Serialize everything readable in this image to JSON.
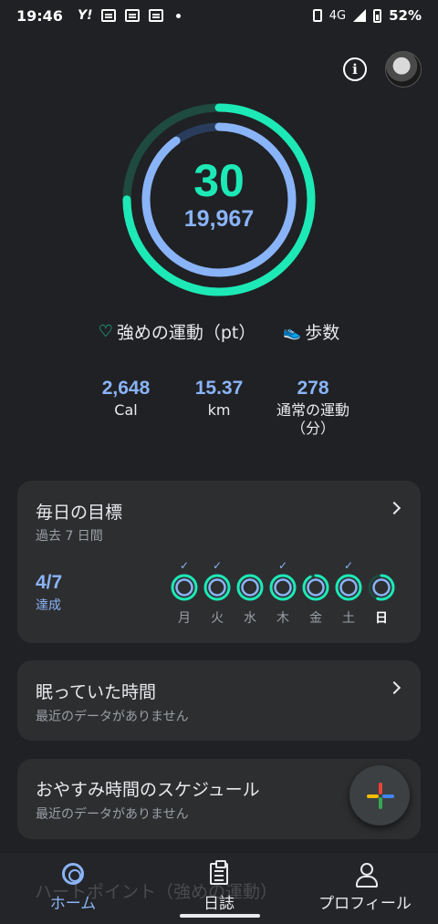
{
  "status_bar": {
    "time": "19:46",
    "yahoo_label": "Y!",
    "network": "4G",
    "battery_pct": "52%"
  },
  "summary": {
    "heart_points": "30",
    "steps": "19,967",
    "heart_points_progress": 0.75,
    "steps_progress": 0.9,
    "legend_heart_points": "強めの運動（pt）",
    "legend_steps": "歩数"
  },
  "stats": [
    {
      "value": "2,648",
      "label": "Cal"
    },
    {
      "value": "15.37",
      "label": "km"
    },
    {
      "value": "278",
      "label": "通常の運動\n（分）"
    }
  ],
  "daily_goals": {
    "title": "毎日の目標",
    "subtitle": "過去 7 日間",
    "achieved_fraction": "4/7",
    "achieved_label": "達成",
    "days": [
      {
        "label": "月",
        "achieved": true,
        "progress": 1.0,
        "today": false
      },
      {
        "label": "火",
        "achieved": true,
        "progress": 1.0,
        "today": false
      },
      {
        "label": "水",
        "achieved": false,
        "progress": 1.0,
        "today": false
      },
      {
        "label": "木",
        "achieved": true,
        "progress": 1.0,
        "today": false
      },
      {
        "label": "金",
        "achieved": false,
        "progress": 0.92,
        "today": false
      },
      {
        "label": "土",
        "achieved": true,
        "progress": 1.0,
        "today": false
      },
      {
        "label": "日",
        "achieved": false,
        "progress": 0.55,
        "today": true
      }
    ]
  },
  "sleep_card": {
    "title": "眠っていた時間",
    "subtitle": "最近のデータがありません"
  },
  "bedtime_card": {
    "title": "おやすみ時間のスケジュール",
    "subtitle": "最近のデータがありません"
  },
  "partial_card_text": "ハートポイント（強めの運動）",
  "bottom_nav": {
    "home": "ホーム",
    "journal": "日誌",
    "profile": "プロフィール"
  },
  "colors": {
    "accent_green": "#1de9b6",
    "accent_blue": "#8ab4f8",
    "background": "#202124",
    "card": "#2d2e30"
  }
}
